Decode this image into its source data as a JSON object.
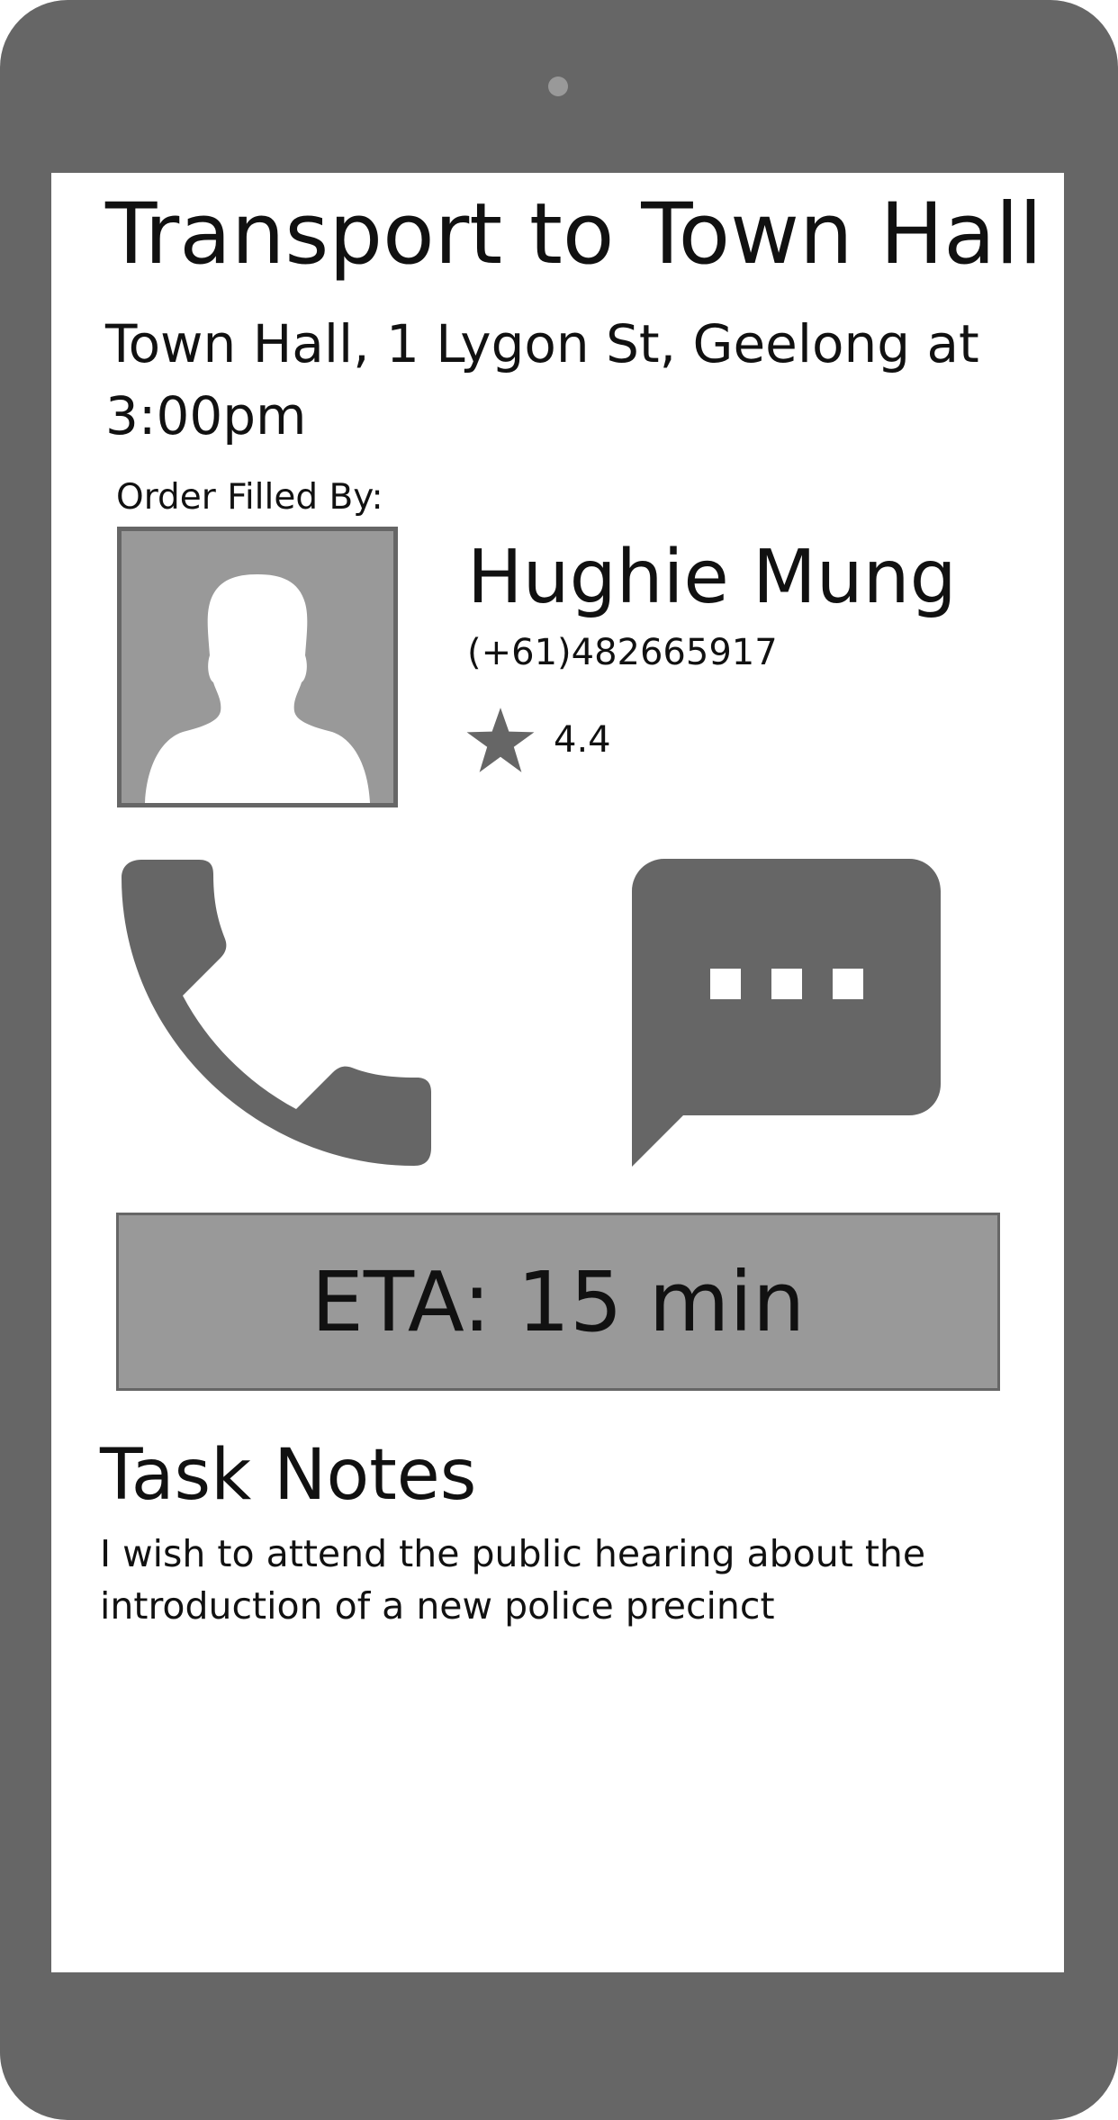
{
  "task": {
    "title": "Transport to Town Hall",
    "location_time": "Town Hall, 1 Lygon St, Geelong at 3:00pm"
  },
  "driver": {
    "section_label": "Order Filled By:",
    "name": "Hughie Mung",
    "phone": "(+61)482665917",
    "rating": "4.4",
    "avatar_icon": "person-silhouette-icon"
  },
  "actions": {
    "call_icon": "phone-icon",
    "message_icon": "chat-bubble-icon"
  },
  "eta": {
    "label": "ETA: 15 min"
  },
  "notes": {
    "heading": "Task Notes",
    "body": "I wish to attend the public hearing about the introduction of a new police precinct"
  },
  "colors": {
    "device_frame": "#666666",
    "screen_background": "#ffffff",
    "panel_gray": "#999999",
    "icon_gray": "#666666",
    "text": "#111111"
  }
}
